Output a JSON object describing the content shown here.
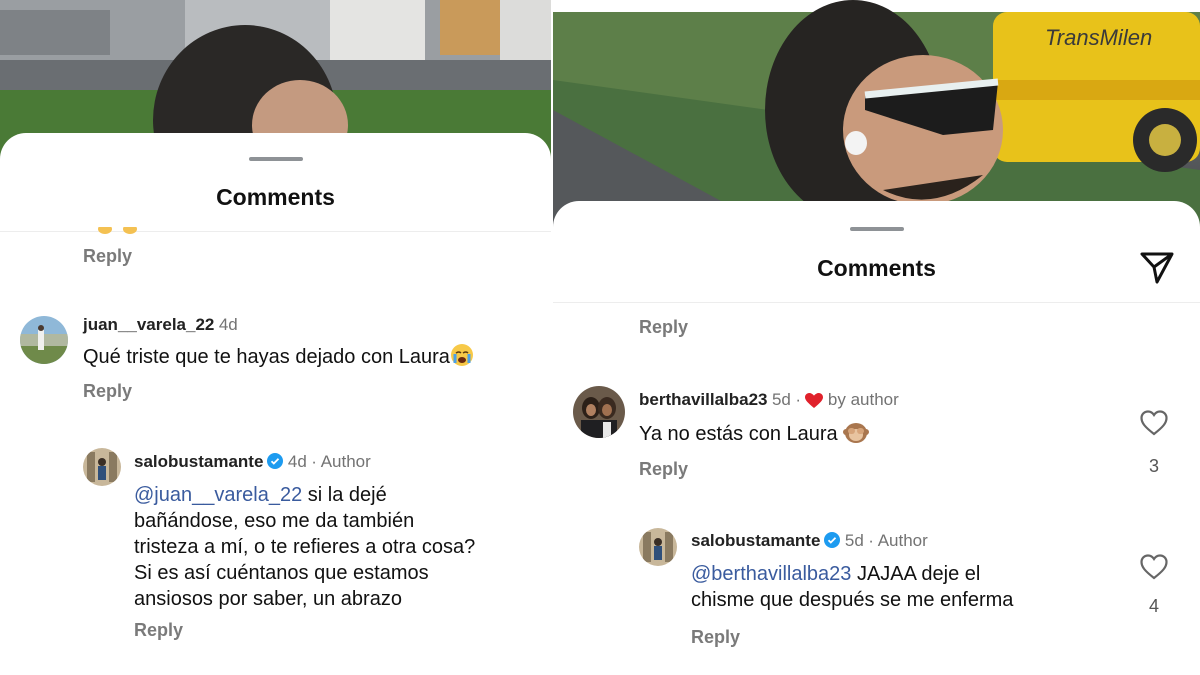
{
  "left": {
    "sheet_title": "Comments",
    "top_reply": "Reply",
    "comments": [
      {
        "username": "juan__varela_22",
        "age": "4d",
        "text": "Qué triste que te hayas dejado con Laura",
        "emoji": "crying-face-emoji",
        "reply": "Reply"
      },
      {
        "username": "salobustamante",
        "age": "4d",
        "author_label": "· Author",
        "mention": "@juan__varela_22",
        "text_lines": [
          " si la dejé",
          "bañándose, eso me da también",
          "tristeza a mí, o te refieres a otra cosa?",
          "Si es así cuéntanos que estamos",
          "ansiosos por saber, un abrazo"
        ],
        "reply": "Reply"
      }
    ]
  },
  "right": {
    "sheet_title": "Comments",
    "top_reply": "Reply",
    "comments": [
      {
        "username": "berthavillalba23",
        "age": "5d",
        "liked_by": "by author",
        "text": "Ya no estás con Laura",
        "emoji": "see-no-evil-monkey-emoji",
        "reply": "Reply",
        "likes": "3"
      },
      {
        "username": "salobustamante",
        "age": "5d",
        "author_label": "· Author",
        "mention": "@berthavillalba23",
        "text_first": " JAJAA deje el",
        "text_second": "chisme que después se me enferma",
        "reply": "Reply",
        "likes": "4"
      }
    ]
  },
  "colors": {
    "mention": "#3a5b9e",
    "verified": "#1d9bf0",
    "heart_red": "#e0212b",
    "muted": "#737373"
  }
}
